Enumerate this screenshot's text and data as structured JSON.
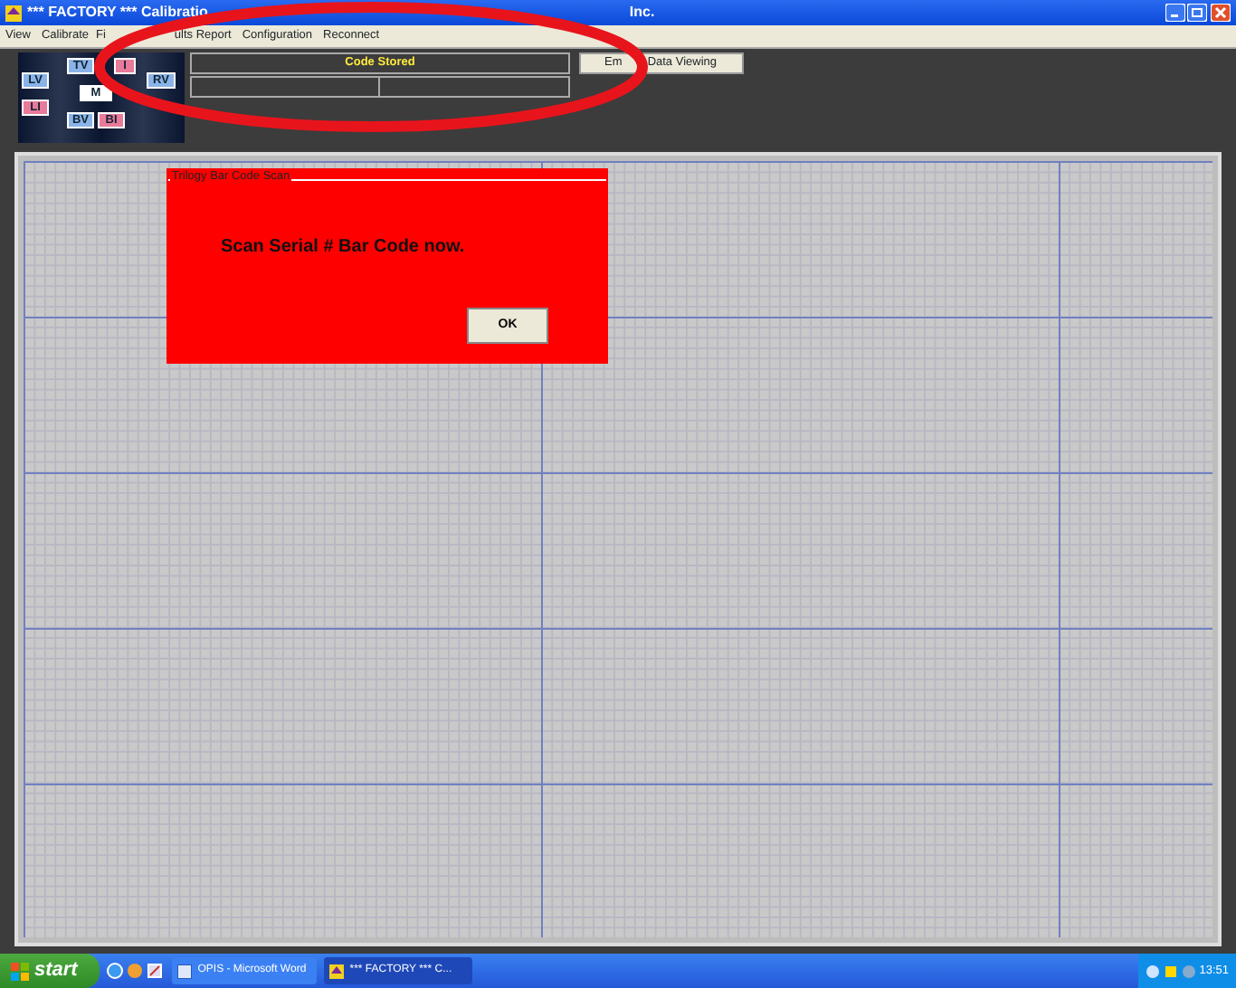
{
  "window": {
    "title": "*** FACTORY *** Calibratio",
    "title_tail": "Inc."
  },
  "menu": [
    "View",
    "Calibrate",
    "Fi",
    "ults Report",
    "Configuration",
    "Reconnect"
  ],
  "channel_buttons": [
    {
      "label": "TV",
      "color": "#8ab4e8"
    },
    {
      "label": "I",
      "color": "#e87a9a"
    },
    {
      "label": "LV",
      "color": "#8ab4e8"
    },
    {
      "label": "RV",
      "color": "#8ab4e8"
    },
    {
      "label": "M",
      "color": "#ffffff"
    },
    {
      "label": "LI",
      "color": "#e87a9a"
    },
    {
      "label": "BV",
      "color": "#8ab4e8"
    },
    {
      "label": "BI",
      "color": "#e87a9a"
    }
  ],
  "status_panel": {
    "header": "Code Stored"
  },
  "mode_button": {
    "label_parts": [
      "Em",
      "Data Viewing"
    ]
  },
  "dialog": {
    "title": "Trilogy Bar Code Scan",
    "message": "Scan Serial # Bar Code now.",
    "button": "OK"
  },
  "taskbar": {
    "start": "start",
    "tasks": [
      {
        "label": "OPIS - Microsoft Word",
        "selected": false
      },
      {
        "label": "*** FACTORY *** C...",
        "selected": true
      }
    ],
    "clock": "13:51"
  }
}
